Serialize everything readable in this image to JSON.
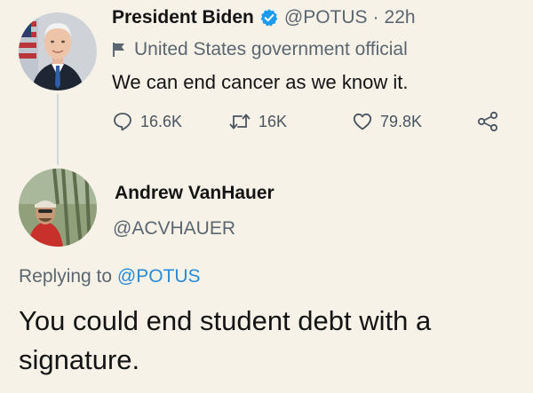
{
  "tweet": {
    "author_name": "President Biden",
    "handle": "@POTUS",
    "separator": "·",
    "time": "22h",
    "label": "United States government official",
    "text": "We can end cancer as we know it.",
    "stats": {
      "replies": "16.6K",
      "retweets": "16K",
      "likes": "79.8K"
    },
    "icons": {
      "verified": "verified-badge-icon",
      "label": "flag-icon",
      "reply": "reply-icon",
      "retweet": "retweet-icon",
      "like": "heart-icon",
      "share": "share-icon"
    },
    "accent_color": "#1d9bf0"
  },
  "reply": {
    "author_name": "Andrew VanHauer",
    "handle": "@ACVHAUER",
    "replying_prefix": "Replying to",
    "replying_to": "@POTUS",
    "text": "You could end student debt with a signature."
  }
}
